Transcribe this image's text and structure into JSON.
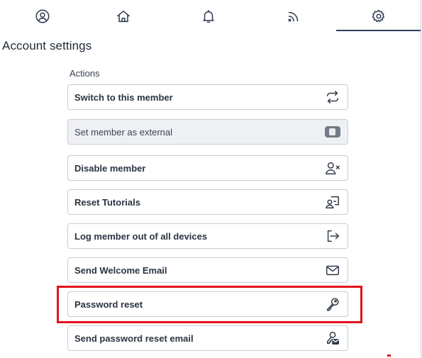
{
  "tabs": [
    {
      "icon": "user-circle-icon",
      "active": false
    },
    {
      "icon": "home-icon",
      "active": false
    },
    {
      "icon": "bell-icon",
      "active": false
    },
    {
      "icon": "rss-icon",
      "active": false
    },
    {
      "icon": "gear-icon",
      "active": true
    }
  ],
  "page": {
    "title": "Account settings"
  },
  "actions_section": {
    "label": "Actions",
    "items": [
      {
        "label": "Switch to this member",
        "icon": "switch-arrows-icon"
      },
      {
        "label": "Set member as external",
        "icon": "toggle-icon",
        "disabled": true
      },
      {
        "label": "Disable member",
        "icon": "user-x-icon"
      },
      {
        "label": "Reset Tutorials",
        "icon": "tutorial-screen-icon"
      },
      {
        "label": "Log member out of all devices",
        "icon": "logout-icon"
      },
      {
        "label": "Send Welcome Email",
        "icon": "mail-icon"
      },
      {
        "label": "Password reset",
        "icon": "key-icon",
        "highlighted": true
      },
      {
        "label": "Send password reset email",
        "icon": "key-mail-icon"
      }
    ]
  },
  "colors": {
    "highlight": "#e0141f",
    "active_tab_underline": "#2b3f57",
    "border": "#c7cdd5"
  }
}
